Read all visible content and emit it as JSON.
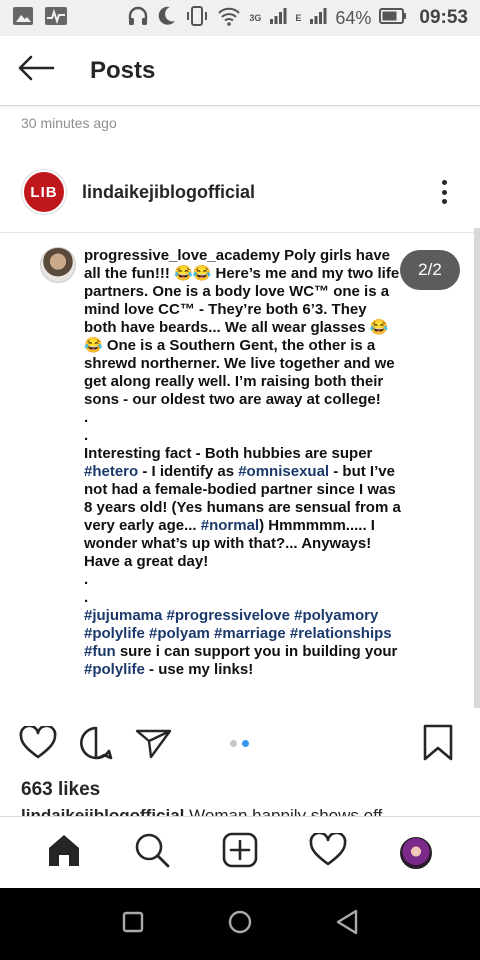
{
  "status_bar": {
    "time": "09:53",
    "battery": "64%",
    "network_a": "3G",
    "network_b": "E",
    "icons": [
      "image-icon",
      "activity-icon",
      "headphones-icon",
      "moon-icon",
      "vibrate-icon",
      "wifi-icon",
      "signal-icon",
      "battery-icon"
    ]
  },
  "header": {
    "title": "Posts"
  },
  "post": {
    "timestamp": "30 minutes ago",
    "username": "lindaikejiblogofficial",
    "avatar_text": "LIB",
    "page_indicator": "2/2",
    "image_text": {
      "username": "progressive_love_academy",
      "line1": " Poly girls have",
      "line2": "all the fun!!! 😂😂 Here’s me and my two life",
      "line3": "partners.  One is a body love WC™ one is a",
      "line4": "mind love CC™ - They’re both 6’3.  They",
      "line5": "both have beards... We all wear glasses 😂",
      "line6": "😂 One is a Southern Gent, the other is a",
      "line7": "shrewd northerner.  We live together and we",
      "line8": "get along really well.  I’m raising both their",
      "line9": "sons - our oldest two are away at college!",
      "dot1": ".",
      "dot2": ".",
      "p2_line1": "Interesting fact - Both hubbies are super",
      "p2_line2_tag": "#hetero",
      "p2_line2_rest": " - I identify as ",
      "p2_line2_tag2": "#omnisexual",
      "p2_line2_end": " - but I’ve",
      "p2_line3": "not had a female-bodied partner since I was",
      "p2_line4": "8 years old! (Yes humans are sensual from a",
      "p2_line5_start": "very early age... ",
      "p2_line5_tag": "#normal",
      "p2_line5_end": ") Hmmmmm..... I",
      "p2_line6": "wonder what’s up with that?... Anyways!",
      "p2_line7": "Have a great day!",
      "dot3": ".",
      "dot4": ".",
      "tags_line1": "#jujumama #progressivelove #polyamory",
      "tags_line2": "#polylife #polyam #marriage #relationships",
      "tags_line3_tag": "#fun",
      "tags_line3_rest": " sure i can support you in building your",
      "tags_line4_tag": "#polylife",
      "tags_line4_rest": " - use my links!"
    },
    "likes": "663 likes",
    "caption_user": "lindaikejiblogofficial",
    "caption_text": " Woman happily shows off"
  },
  "colors": {
    "accent_blue": "#3897f0",
    "lib_red": "#c0171d",
    "hashtag": "#1b3a6b"
  }
}
